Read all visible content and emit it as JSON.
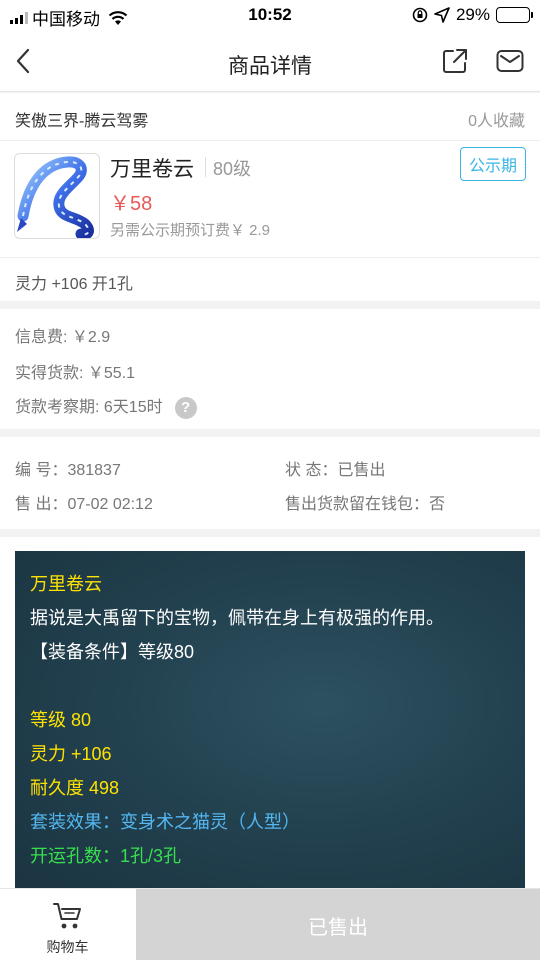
{
  "statusbar": {
    "carrier": "中国移动",
    "time": "10:52",
    "battery_percent": "29%",
    "battery_level": 0.29
  },
  "nav": {
    "title": "商品详情",
    "icons": [
      "back-icon",
      "share-icon",
      "mail-icon"
    ]
  },
  "item": {
    "server": "笑傲三界-腾云驾雾",
    "favorites": "0人收藏",
    "name": "万里卷云",
    "level": "80级",
    "price": "￥58",
    "extra_fee": "另需公示期预订费￥ 2.9",
    "badge": "公示期",
    "attribute": "灵力 +106 开1孔"
  },
  "fees": {
    "info_fee": "信息费: ￥2.9",
    "actual_payment": "实得货款: ￥55.1",
    "review_period": "货款考察期: 6天15时",
    "help_icon": "?"
  },
  "order": {
    "number": "编 号：381837",
    "status": "状 态：已售出",
    "sold_time": "售 出：07-02 02:12",
    "wallet": "售出货款留在钱包：否"
  },
  "description": {
    "title": "万里卷云",
    "lore": "据说是大禹留下的宝物，佩带在身上有极强的作用。",
    "requirement": "【装备条件】等级80",
    "level": "等级 80",
    "spirit": "灵力 +106",
    "durability": "耐久度 498",
    "set_effect": "套装效果：变身术之猫灵（人型）",
    "slots": "开运孔数：1孔/3孔"
  },
  "bottom": {
    "cart_label": "购物车",
    "sold_label": "已售出"
  },
  "colors": {
    "price": "#e85a58",
    "badge": "#3ab5e6",
    "desc_bg": "#213f4d",
    "desc_yellow": "#ffe200",
    "desc_blue": "#54b7f0",
    "desc_green": "#36e04c"
  }
}
